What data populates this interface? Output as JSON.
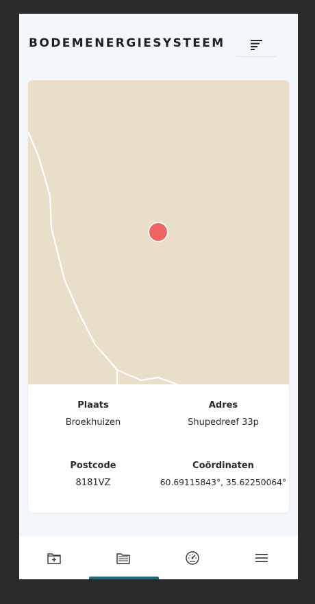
{
  "header": {
    "title": "BODEMENERGIESYSTEEM",
    "menu_icon": "list-icon"
  },
  "map": {
    "marker_color": "#f06464",
    "background_color": "#e9dfc8"
  },
  "details": {
    "plaats": {
      "label": "Plaats",
      "value": "Broekhuizen"
    },
    "adres": {
      "label": "Adres",
      "value": "Shupedreef 33p"
    },
    "postcode": {
      "label": "Postcode",
      "value": "8181VZ"
    },
    "coordinaten": {
      "label": "Coördinaten",
      "value": "60.69115843°, 35.62250064°"
    }
  },
  "bottom_nav": {
    "items": [
      {
        "icon": "folder-add-icon"
      },
      {
        "icon": "folders-icon",
        "active": true
      },
      {
        "icon": "dashboard-gauge-icon"
      },
      {
        "icon": "hamburger-menu-icon"
      }
    ],
    "active_color": "#1d6e82"
  }
}
